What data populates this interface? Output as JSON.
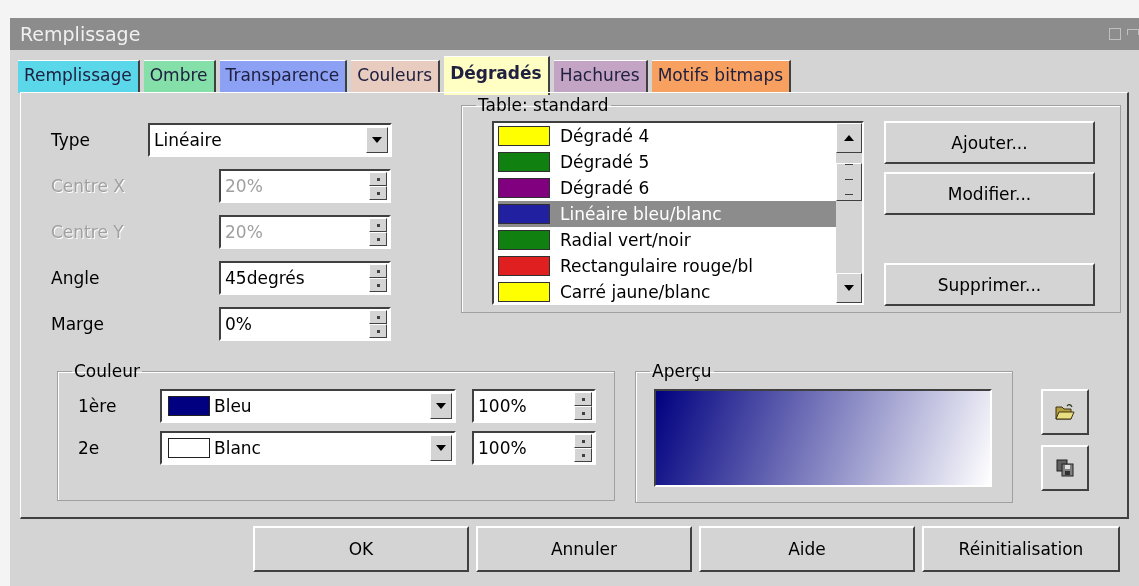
{
  "window": {
    "title": "Remplissage"
  },
  "tabs": [
    {
      "label": "Remplissage",
      "color": "#5ad8ea",
      "selected": false
    },
    {
      "label": "Ombre",
      "color": "#84e0a8",
      "selected": false
    },
    {
      "label": "Transparence",
      "color": "#8ca0f4",
      "selected": false
    },
    {
      "label": "Couleurs",
      "color": "#e8ccc0",
      "selected": false
    },
    {
      "label": "Dégradés",
      "color": "#ffffc4",
      "selected": true
    },
    {
      "label": "Hachures",
      "color": "#c4a4c4",
      "selected": false
    },
    {
      "label": "Motifs bitmaps",
      "color": "#f8a060",
      "selected": false
    }
  ],
  "fields": [
    {
      "label": "Type",
      "kind": "select",
      "value": "Linéaire",
      "disabled": false
    },
    {
      "label": "Centre X",
      "kind": "spin",
      "value": "20%",
      "disabled": true
    },
    {
      "label": "Centre Y",
      "kind": "spin",
      "value": "20%",
      "disabled": true
    },
    {
      "label": "Angle",
      "kind": "spin",
      "value": "45degrés",
      "disabled": false
    },
    {
      "label": "Marge",
      "kind": "spin",
      "value": "0%",
      "disabled": false
    }
  ],
  "table": {
    "title": "Table: standard",
    "items": [
      {
        "name": "Dégradé 4",
        "color": "#ffff00",
        "selected": false
      },
      {
        "name": "Dégradé 5",
        "color": "#108010",
        "selected": false
      },
      {
        "name": "Dégradé 6",
        "color": "#800080",
        "selected": false
      },
      {
        "name": "Linéaire bleu/blanc",
        "color": "#2020a0",
        "selected": true
      },
      {
        "name": "Radial vert/noir",
        "color": "#108010",
        "selected": false
      },
      {
        "name": "Rectangulaire rouge/bl",
        "color": "#e02020",
        "selected": false
      },
      {
        "name": "Carré jaune/blanc",
        "color": "#ffff00",
        "selected": false
      }
    ],
    "buttons": [
      "Ajouter...",
      "Modifier...",
      "Supprimer..."
    ]
  },
  "colors": {
    "title": "Couleur",
    "rows": [
      {
        "label": "1ère",
        "color": "#000080",
        "value": "Bleu",
        "percent": "100%"
      },
      {
        "label": "2e",
        "color": "#ffffff",
        "value": "Blanc",
        "percent": "100%"
      }
    ]
  },
  "preview": {
    "title": "Aperçu"
  },
  "buttons": [
    "OK",
    "Annuler",
    "Aide",
    "Réinitialisation"
  ]
}
